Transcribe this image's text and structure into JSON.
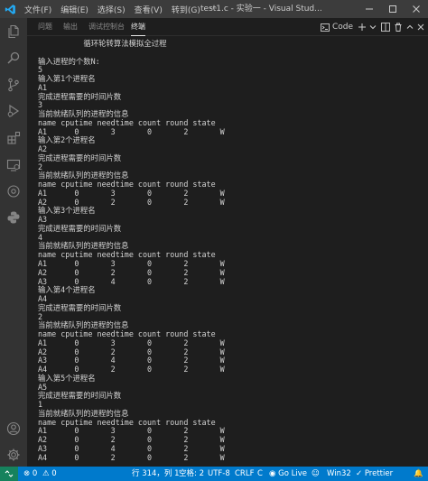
{
  "titlebar": {
    "menu": [
      "文件(F)",
      "编辑(E)",
      "选择(S)",
      "查看(V)",
      "转到(G)",
      "···"
    ],
    "window_title": "test1.c - 实验一 - Visual Stud..."
  },
  "panel": {
    "tabs": [
      "问题",
      "输出",
      "调试控制台",
      "终端"
    ],
    "active_tab": "终端",
    "terminal_select": "Code"
  },
  "terminal": {
    "lines": [
      "          循环轮转算法模拟全过程",
      "",
      "输入进程的个数N:",
      "5",
      "输入第1个进程名",
      "A1",
      "完成进程需要的时间片数",
      "3",
      "当前就绪队列的进程的信息",
      "name cputime needtime count round state",
      "A1      0       3       0       2       W",
      "输入第2个进程名",
      "A2",
      "完成进程需要的时间片数",
      "2",
      "当前就绪队列的进程的信息",
      "name cputime needtime count round state",
      "A1      0       3       0       2       W",
      "A2      0       2       0       2       W",
      "输入第3个进程名",
      "A3",
      "完成进程需要的时间片数",
      "4",
      "当前就绪队列的进程的信息",
      "name cputime needtime count round state",
      "A1      0       3       0       2       W",
      "A2      0       2       0       2       W",
      "A3      0       4       0       2       W",
      "输入第4个进程名",
      "A4",
      "完成进程需要的时间片数",
      "2",
      "当前就绪队列的进程的信息",
      "name cputime needtime count round state",
      "A1      0       3       0       2       W",
      "A2      0       2       0       2       W",
      "A3      0       4       0       2       W",
      "A4      0       2       0       2       W",
      "输入第5个进程名",
      "A5",
      "完成进程需要的时间片数",
      "1",
      "当前就绪队列的进程的信息",
      "name cputime needtime count round state",
      "A1      0       3       0       2       W",
      "A2      0       2       0       2       W",
      "A3      0       4       0       2       W",
      "A4      0       2       0       2       W"
    ]
  },
  "statusbar": {
    "errors": "0",
    "warnings": "0",
    "position": "行 314，列 1",
    "spaces": "空格: 2",
    "encoding": "UTF-8",
    "eol": "CRLF",
    "language": "C",
    "golive": "Go Live",
    "platform": "Win32",
    "prettier": "Prettier"
  },
  "colors": {
    "accent": "#007acc",
    "remote": "#16825d",
    "vscode_logo": "#23a9f2"
  }
}
